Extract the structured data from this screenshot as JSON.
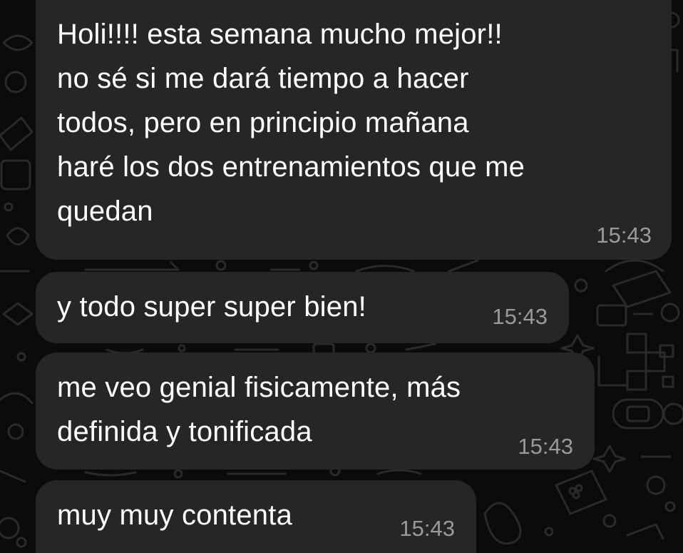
{
  "messages": [
    {
      "lines": [
        "Holi!!!! esta semana mucho mejor!!",
        "no sé si me dará tiempo a hacer",
        "todos, pero en principio mañana",
        "haré los dos entrenamientos que me",
        "quedan"
      ],
      "time": "15:43"
    },
    {
      "lines": [
        "y todo super super bien!"
      ],
      "time": "15:43"
    },
    {
      "lines": [
        "me veo genial fisicamente, más",
        "definida y tonificada"
      ],
      "time": "15:43"
    },
    {
      "lines": [
        "muy muy contenta"
      ],
      "time": "15:43"
    }
  ],
  "colors": {
    "background": "#0b0b0b",
    "bubble": "#262626",
    "text": "#ffffff",
    "timestamp": "#9a9a9a",
    "doodles": "#2a2a2a"
  }
}
